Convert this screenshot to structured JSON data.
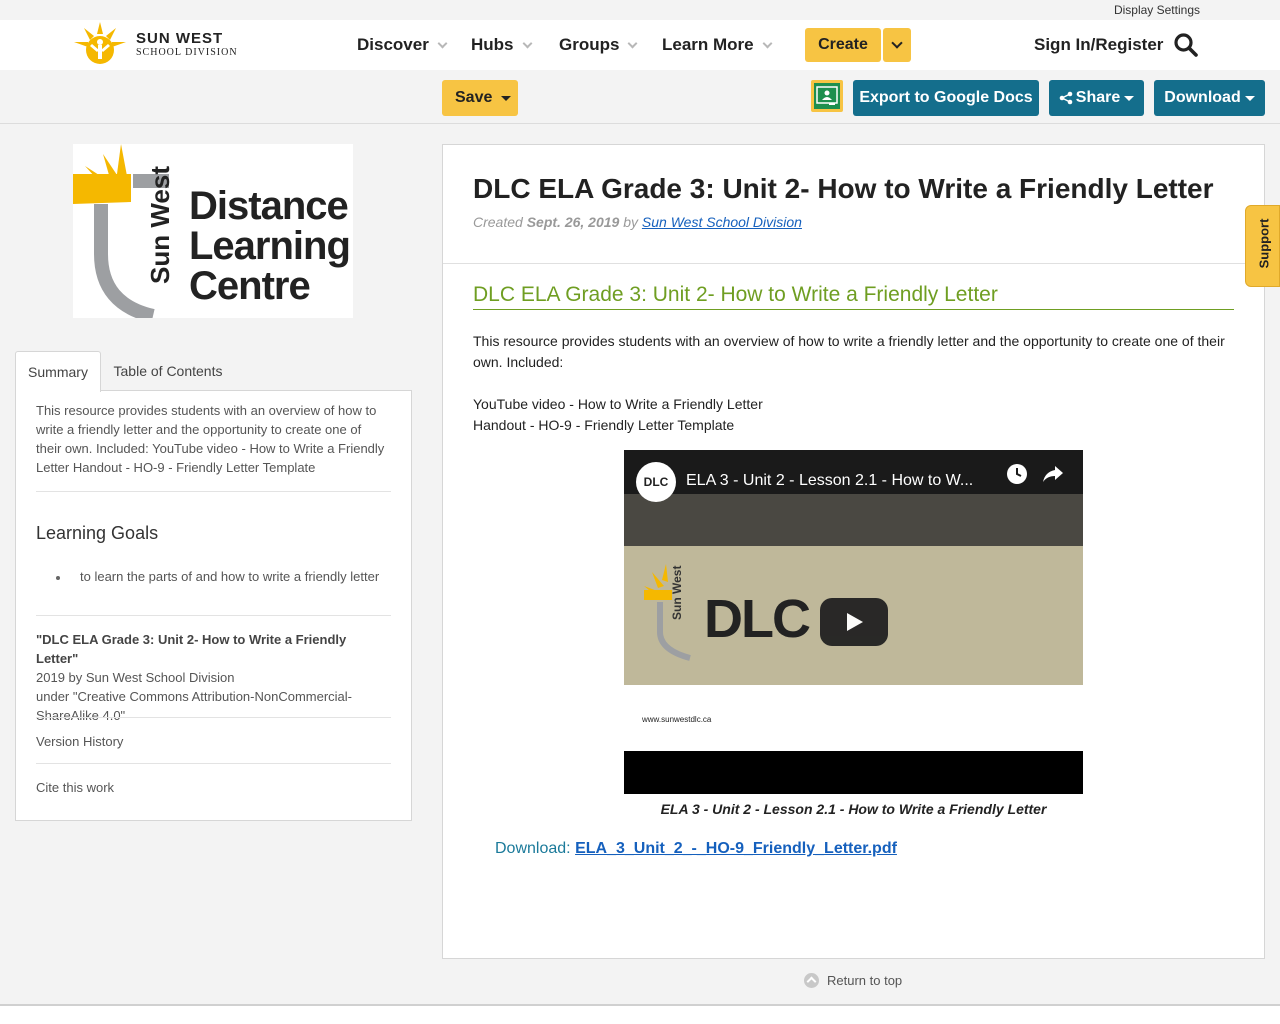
{
  "util": {
    "display_settings": "Display Settings"
  },
  "header": {
    "brand_line1": "SUN WEST",
    "brand_line2": "SCHOOL DIVISION",
    "nav": [
      "Discover",
      "Hubs",
      "Groups",
      "Learn More"
    ],
    "create_label": "Create",
    "signin_label": "Sign In/Register"
  },
  "actions": {
    "save_label": "Save",
    "export_label": "Export to Google Docs",
    "share_label": "Share",
    "download_label": "Download"
  },
  "sidebar": {
    "logo_text": [
      "Distance",
      "Learning",
      "Centre"
    ],
    "logo_vertical": "Sun West",
    "tabs": [
      "Summary",
      "Table of Contents"
    ],
    "summary": "This resource provides students with an overview of how to write a friendly letter and the opportunity to create one of their own. Included: YouTube video - How to Write a Friendly Letter Handout - HO-9 - Friendly Letter Template",
    "learning_goals_title": "Learning Goals",
    "learning_goals": [
      "to learn the parts of and how to write a friendly letter"
    ],
    "attribution_title": "\"DLC ELA Grade 3: Unit 2- How to Write a Friendly Letter\"",
    "attribution_line2": "2019 by Sun West School Division",
    "attribution_line3": "under \"Creative Commons Attribution-NonCommercial-ShareAlike 4.0\"",
    "version_history": "Version History",
    "cite": "Cite this work"
  },
  "main": {
    "title": "DLC ELA Grade 3: Unit 2- How to Write a Friendly Letter",
    "created_prefix": "Created",
    "created_date": "Sept. 26, 2019",
    "created_by": "by",
    "author": "Sun West School Division",
    "section_heading": "DLC ELA Grade 3: Unit 2- How to Write a Friendly Letter",
    "intro": "This resource provides students with an overview of how to write a friendly letter and the opportunity to create one of their own. Included:",
    "included_1": "YouTube video - How to Write a Friendly Letter",
    "included_2": "Handout - HO-9 - Friendly Letter Template",
    "video": {
      "title": "ELA 3 - Unit 2 - Lesson 2.1 - How to W...",
      "channel": "DLC",
      "slide_brand": "DLC",
      "slide_vertical": "Sun West",
      "slide_url": "www.sunwestdlc.ca"
    },
    "caption": "ELA 3 - Unit 2 - Lesson 2.1 - How to Write a Friendly Letter",
    "download_prefix": "Download:",
    "download_file": "ELA_3_Unit_2_-_HO-9_Friendly_Letter.pdf"
  },
  "support_label": "Support",
  "return_label": "Return to top",
  "colors": {
    "accent_yellow": "#f7c443",
    "action_blue": "#146e8c",
    "heading_green": "#6f9e22",
    "link_blue": "#1560bd"
  }
}
